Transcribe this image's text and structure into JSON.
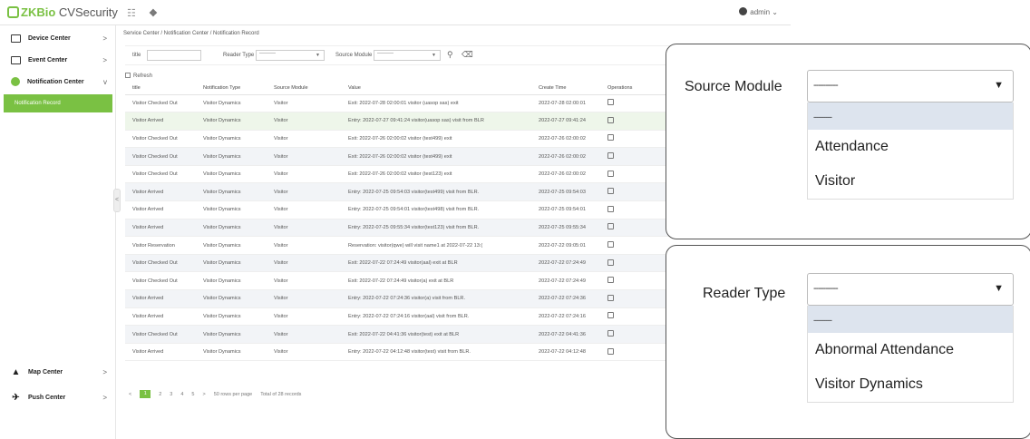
{
  "app": {
    "logo_brand": "ZKBio",
    "logo_product": " CVSecurity",
    "menu_icon": "grid-icon",
    "expand_icon": "expand-icon",
    "user": "admin"
  },
  "sidebar": {
    "items": [
      {
        "label": "Device Center",
        "chevron": ">"
      },
      {
        "label": "Event Center",
        "chevron": ">"
      },
      {
        "label": "Notification Center",
        "chevron": "v"
      },
      {
        "label": "Map Center",
        "chevron": ">"
      },
      {
        "label": "Push Center",
        "chevron": ">"
      }
    ],
    "active_sub": "Notification Record",
    "collapse_glyph": "<"
  },
  "breadcrumb": "Service Center / Notification Center / Notification Record",
  "filters": {
    "title_label": "title",
    "reader_type_label": "Reader Type",
    "reader_type_value": "---------",
    "source_module_label": "Source Module",
    "source_module_value": "---------"
  },
  "toolbar": {
    "refresh": "Refresh"
  },
  "table": {
    "headers": [
      "title",
      "Notification Type",
      "Source Module",
      "Value",
      "Create Time",
      "Operations"
    ],
    "rows": [
      [
        "Visitor Checked Out",
        "Visitor Dynamics",
        "Visitor",
        "Exit: 2022-07-28 02:00:01 visitor (uasop sas) exit",
        "2022-07-28 02:00:01"
      ],
      [
        "Visitor Arrived",
        "Visitor Dynamics",
        "Visitor",
        "Entry: 2022-07-27 09:41:24 visitor(uasop sas) visit from BLR",
        "2022-07-27 09:41:24"
      ],
      [
        "Visitor Checked Out",
        "Visitor Dynamics",
        "Visitor",
        "Exit: 2022-07-26 02:00:02 visitor (test499) exit",
        "2022-07-26 02:00:02"
      ],
      [
        "Visitor Checked Out",
        "Visitor Dynamics",
        "Visitor",
        "Exit: 2022-07-26 02:00:02 visitor (test499) exit",
        "2022-07-26 02:00:02"
      ],
      [
        "Visitor Checked Out",
        "Visitor Dynamics",
        "Visitor",
        "Exit: 2022-07-26 02:00:02 visitor (test123) exit",
        "2022-07-26 02:00:02"
      ],
      [
        "Visitor Arrived",
        "Visitor Dynamics",
        "Visitor",
        "Entry: 2022-07-25 09:54:03 visitor(test499) visit from BLR.",
        "2022-07-25 09:54:03"
      ],
      [
        "Visitor Arrived",
        "Visitor Dynamics",
        "Visitor",
        "Entry: 2022-07-25 09:54:01 visitor(test498) visit from BLR.",
        "2022-07-25 09:54:01"
      ],
      [
        "Visitor Arrived",
        "Visitor Dynamics",
        "Visitor",
        "Entry: 2022-07-25 09:55:34 visitor(test123) visit from BLR.",
        "2022-07-25 09:55:34"
      ],
      [
        "Visitor Reservation",
        "Visitor Dynamics",
        "Visitor",
        "Reservation: visitor(qwe) will visit name1 at 2022-07-22 13:(",
        "2022-07-22 09:05:01"
      ],
      [
        "Visitor Checked Out",
        "Visitor Dynamics",
        "Visitor",
        "Exit: 2022-07-22 07:24:49 visitor(aal) exit at BLR",
        "2022-07-22 07:24:49"
      ],
      [
        "Visitor Checked Out",
        "Visitor Dynamics",
        "Visitor",
        "Exit: 2022-07-22 07:24:49 visitor(a) exit at BLR",
        "2022-07-22 07:24:49"
      ],
      [
        "Visitor Arrived",
        "Visitor Dynamics",
        "Visitor",
        "Entry: 2022-07-22 07:24:36 visitor(a) visit from BLR.",
        "2022-07-22 07:24:36"
      ],
      [
        "Visitor Arrived",
        "Visitor Dynamics",
        "Visitor",
        "Entry: 2022-07-22 07:24:16 visitor(aal) visit from BLR.",
        "2022-07-22 07:24:16"
      ],
      [
        "Visitor Checked Out",
        "Visitor Dynamics",
        "Visitor",
        "Exit: 2022-07-22 04:41:36 visitor(test) exit at BLR",
        "2022-07-22 04:41:36"
      ],
      [
        "Visitor Arrived",
        "Visitor Dynamics",
        "Visitor",
        "Entry: 2022-07-22 04:12:48 visitor(test) visit from BLR.",
        "2022-07-22 04:12:48"
      ]
    ]
  },
  "pager": {
    "prev": "<",
    "pages": [
      "1",
      "2",
      "3",
      "4",
      "5"
    ],
    "next": ">",
    "per_page": "50 rows per page",
    "total": "Total of 28 records"
  },
  "callout_source": {
    "label": "Source Module",
    "value": "----------",
    "selected_option": "----------",
    "options": [
      "Attendance",
      "Visitor"
    ]
  },
  "callout_reader": {
    "label": "Reader Type",
    "value": "----------",
    "selected_option": "----------",
    "options": [
      "Abnormal Attendance",
      "Visitor Dynamics"
    ]
  },
  "colors": {
    "accent": "#7ac143",
    "row_alt": "#f2f4f7",
    "selected_option": "#dde4ee"
  }
}
